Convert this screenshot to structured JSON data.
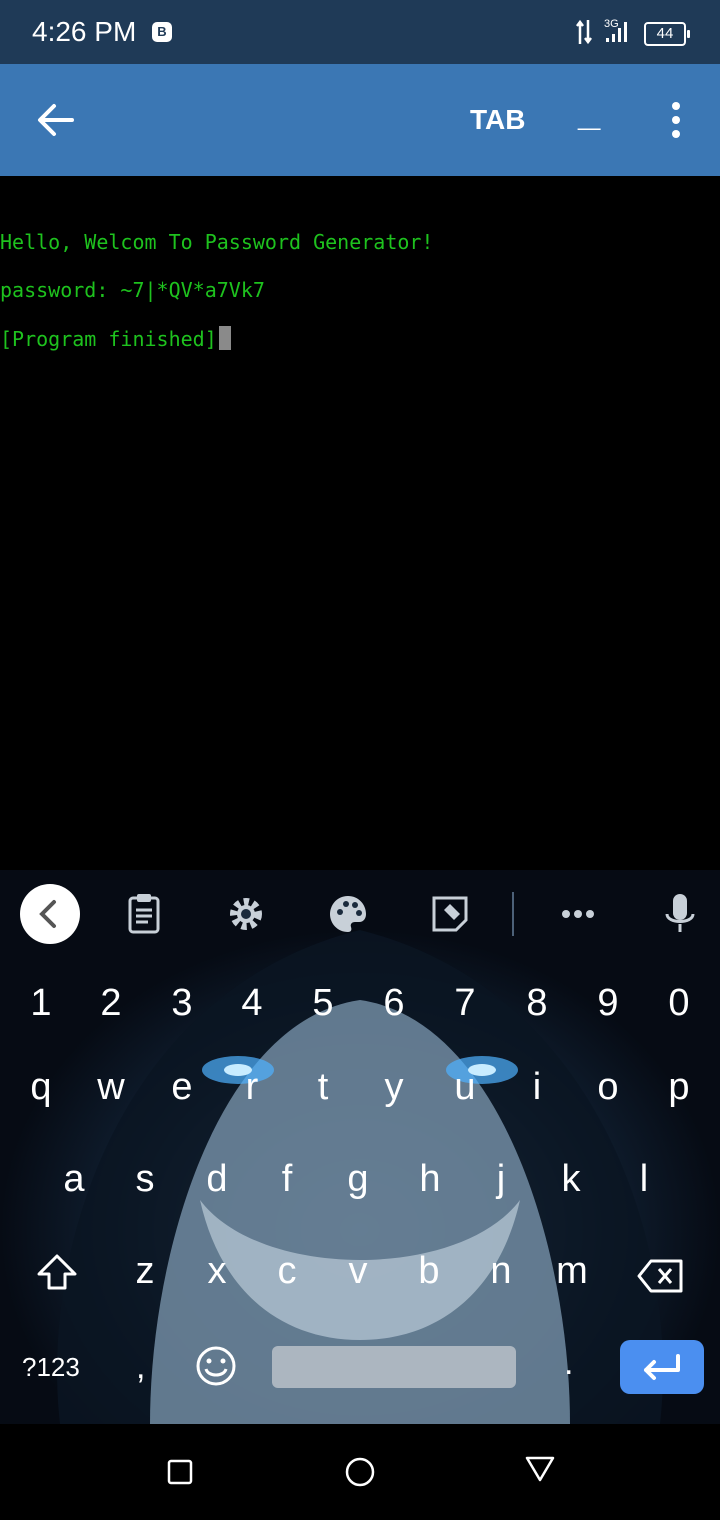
{
  "status_bar": {
    "time": "4:26 PM",
    "notification_icon": "coin-icon",
    "network": "3G",
    "battery": "44"
  },
  "app_bar": {
    "back_icon": "arrow-left-icon",
    "tab_label": "TAB",
    "underscore_label": "_",
    "more_icon": "more-vert-icon",
    "background": "#3b77b4"
  },
  "terminal": {
    "lines": [
      "Hello, Welcom To Password Generator!",
      "password: ~7|*QV*a7Vk7",
      "[Program finished]"
    ],
    "text_color": "#1ec21e"
  },
  "keyboard": {
    "toolbar": [
      "chevron-left-icon",
      "clipboard-icon",
      "gear-icon",
      "palette-icon",
      "sticker-icon",
      "more-horiz-icon",
      "mic-icon"
    ],
    "numbers": [
      "1",
      "2",
      "3",
      "4",
      "5",
      "6",
      "7",
      "8",
      "9",
      "0"
    ],
    "row1": [
      "q",
      "w",
      "e",
      "r",
      "t",
      "y",
      "u",
      "i",
      "o",
      "p"
    ],
    "row2": [
      "a",
      "s",
      "d",
      "f",
      "g",
      "h",
      "j",
      "k",
      "l"
    ],
    "row3": [
      "z",
      "x",
      "c",
      "v",
      "b",
      "n",
      "m"
    ],
    "symbols_label": "?123",
    "comma": ",",
    "period": ".",
    "enter_color": "#4b8ff0"
  },
  "nav_bar": [
    "recents-square-icon",
    "home-circle-icon",
    "back-triangle-icon"
  ]
}
